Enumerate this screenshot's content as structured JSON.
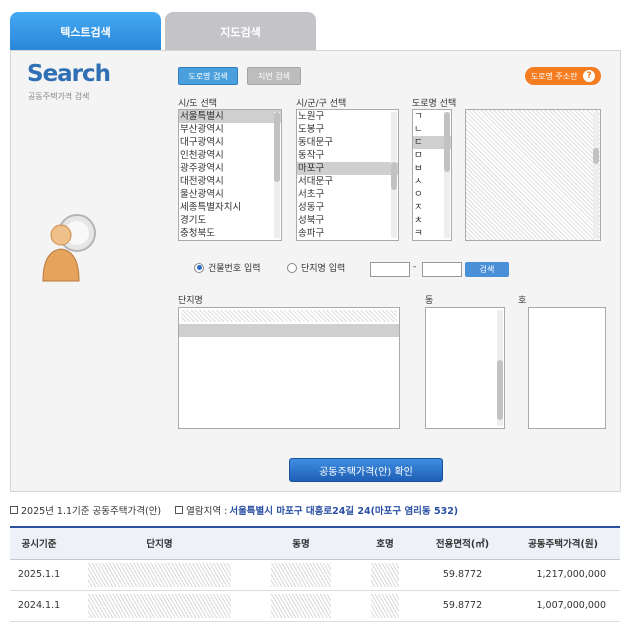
{
  "tabs": [
    {
      "label": "텍스트검색"
    },
    {
      "label": "지도검색"
    }
  ],
  "logo": {
    "title": "Search",
    "subtitle": "공동주택가격 검색"
  },
  "buttons": {
    "road_search": "도로명 검색",
    "lot_search": "지번 검색",
    "road_info": "도로명 주소란",
    "search": "검색",
    "confirm": "공동주택가격(안) 확인"
  },
  "columns": {
    "sido": "시/도 선택",
    "sigungu": "시/군/구 선택",
    "road": "도로명 선택"
  },
  "sido_items": [
    "서울특별시",
    "부산광역시",
    "대구광역시",
    "인천광역시",
    "광주광역시",
    "대전광역시",
    "울산광역시",
    "세종특별자치시",
    "경기도",
    "충청북도"
  ],
  "sigungu_items": [
    "노원구",
    "도봉구",
    "동대문구",
    "동작구",
    "마포구",
    "서대문구",
    "서초구",
    "성동구",
    "성북구",
    "송파구"
  ],
  "road_initials": [
    "ㄱ",
    "ㄴ",
    "ㄷ",
    "ㅁ",
    "ㅂ",
    "ㅅ",
    "ㅇ",
    "ㅈ",
    "ㅊ",
    "ㅋ"
  ],
  "radios": {
    "building_no": "건물번호 입력",
    "complex_name": "단지명 입력"
  },
  "sub_labels": {
    "complex": "단지명",
    "dong": "동",
    "ho": "호"
  },
  "info": {
    "base": "2025년 1.1기준 공동주택가격(안)",
    "viewing_label": "열람지역 :",
    "location": "서울특별시 마포구 대흥로24길 24(마포구 염리동 532)"
  },
  "table": {
    "headers": [
      "공시기준",
      "단지명",
      "동명",
      "호명",
      "전용면적(㎡)",
      "공동주택가격(원)"
    ],
    "rows": [
      {
        "base": "2025.1.1",
        "area": "59.8772",
        "price": "1,217,000,000"
      },
      {
        "base": "2024.1.1",
        "area": "59.8772",
        "price": "1,007,000,000"
      }
    ]
  }
}
